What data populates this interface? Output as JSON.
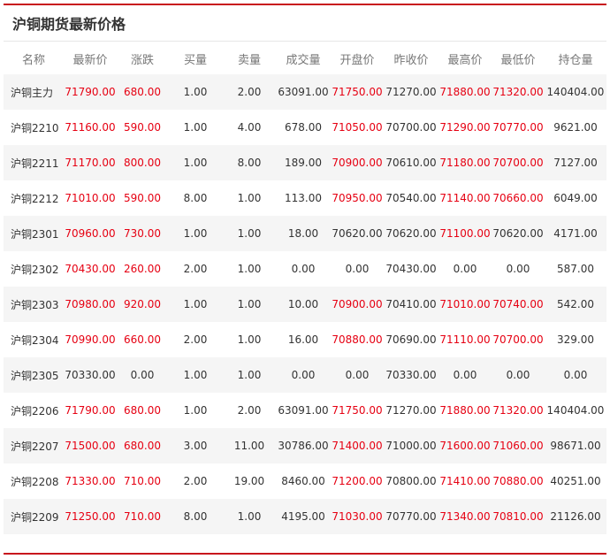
{
  "title": "沪铜期货最新价格",
  "colors": {
    "accent_rule": "#c8161d",
    "up": "#e60012",
    "stripe": "#f5f5f5"
  },
  "columns": [
    "名称",
    "最新价",
    "涨跌",
    "买量",
    "卖量",
    "成交量",
    "开盘价",
    "昨收价",
    "最高价",
    "最低价",
    "持仓量"
  ],
  "rows": [
    {
      "name": "沪铜主力",
      "last": "71790.00",
      "change": "680.00",
      "bid_vol": "1.00",
      "ask_vol": "2.00",
      "volume": "63091.00",
      "open": "71750.00",
      "prev_close": "71270.00",
      "high": "71880.00",
      "low": "71320.00",
      "open_interest": "140404.00",
      "red": [
        "last",
        "change",
        "open",
        "high",
        "low"
      ]
    },
    {
      "name": "沪铜2210",
      "last": "71160.00",
      "change": "590.00",
      "bid_vol": "1.00",
      "ask_vol": "4.00",
      "volume": "678.00",
      "open": "71050.00",
      "prev_close": "70700.00",
      "high": "71290.00",
      "low": "70770.00",
      "open_interest": "9621.00",
      "red": [
        "last",
        "change",
        "open",
        "high",
        "low"
      ]
    },
    {
      "name": "沪铜2211",
      "last": "71170.00",
      "change": "800.00",
      "bid_vol": "1.00",
      "ask_vol": "8.00",
      "volume": "189.00",
      "open": "70900.00",
      "prev_close": "70610.00",
      "high": "71180.00",
      "low": "70700.00",
      "open_interest": "7127.00",
      "red": [
        "last",
        "change",
        "open",
        "high",
        "low"
      ]
    },
    {
      "name": "沪铜2212",
      "last": "71010.00",
      "change": "590.00",
      "bid_vol": "8.00",
      "ask_vol": "1.00",
      "volume": "113.00",
      "open": "70950.00",
      "prev_close": "70540.00",
      "high": "71140.00",
      "low": "70660.00",
      "open_interest": "6049.00",
      "red": [
        "last",
        "change",
        "open",
        "high",
        "low"
      ]
    },
    {
      "name": "沪铜2301",
      "last": "70960.00",
      "change": "730.00",
      "bid_vol": "1.00",
      "ask_vol": "1.00",
      "volume": "18.00",
      "open": "70620.00",
      "prev_close": "70620.00",
      "high": "71100.00",
      "low": "70620.00",
      "open_interest": "4171.00",
      "red": [
        "last",
        "change",
        "high"
      ]
    },
    {
      "name": "沪铜2302",
      "last": "70430.00",
      "change": "260.00",
      "bid_vol": "2.00",
      "ask_vol": "1.00",
      "volume": "0.00",
      "open": "0.00",
      "prev_close": "70430.00",
      "high": "0.00",
      "low": "0.00",
      "open_interest": "587.00",
      "red": [
        "last",
        "change"
      ]
    },
    {
      "name": "沪铜2303",
      "last": "70980.00",
      "change": "920.00",
      "bid_vol": "1.00",
      "ask_vol": "1.00",
      "volume": "10.00",
      "open": "70900.00",
      "prev_close": "70410.00",
      "high": "71010.00",
      "low": "70740.00",
      "open_interest": "542.00",
      "red": [
        "last",
        "change",
        "open",
        "high",
        "low"
      ]
    },
    {
      "name": "沪铜2304",
      "last": "70990.00",
      "change": "660.00",
      "bid_vol": "2.00",
      "ask_vol": "1.00",
      "volume": "16.00",
      "open": "70880.00",
      "prev_close": "70690.00",
      "high": "71110.00",
      "low": "70700.00",
      "open_interest": "329.00",
      "red": [
        "last",
        "change",
        "open",
        "high",
        "low"
      ]
    },
    {
      "name": "沪铜2305",
      "last": "70330.00",
      "change": "0.00",
      "bid_vol": "1.00",
      "ask_vol": "1.00",
      "volume": "0.00",
      "open": "0.00",
      "prev_close": "70330.00",
      "high": "0.00",
      "low": "0.00",
      "open_interest": "0.00",
      "red": []
    },
    {
      "name": "沪铜2206",
      "last": "71790.00",
      "change": "680.00",
      "bid_vol": "1.00",
      "ask_vol": "2.00",
      "volume": "63091.00",
      "open": "71750.00",
      "prev_close": "71270.00",
      "high": "71880.00",
      "low": "71320.00",
      "open_interest": "140404.00",
      "red": [
        "last",
        "change",
        "open",
        "high",
        "low"
      ]
    },
    {
      "name": "沪铜2207",
      "last": "71500.00",
      "change": "680.00",
      "bid_vol": "3.00",
      "ask_vol": "11.00",
      "volume": "30786.00",
      "open": "71400.00",
      "prev_close": "71000.00",
      "high": "71600.00",
      "low": "71060.00",
      "open_interest": "98671.00",
      "red": [
        "last",
        "change",
        "open",
        "high",
        "low"
      ]
    },
    {
      "name": "沪铜2208",
      "last": "71330.00",
      "change": "710.00",
      "bid_vol": "2.00",
      "ask_vol": "19.00",
      "volume": "8460.00",
      "open": "71200.00",
      "prev_close": "70800.00",
      "high": "71410.00",
      "low": "70880.00",
      "open_interest": "40251.00",
      "red": [
        "last",
        "change",
        "open",
        "high",
        "low"
      ]
    },
    {
      "name": "沪铜2209",
      "last": "71250.00",
      "change": "710.00",
      "bid_vol": "8.00",
      "ask_vol": "1.00",
      "volume": "4195.00",
      "open": "71030.00",
      "prev_close": "70770.00",
      "high": "71340.00",
      "low": "70810.00",
      "open_interest": "21126.00",
      "red": [
        "last",
        "change",
        "open",
        "high",
        "low"
      ]
    }
  ]
}
